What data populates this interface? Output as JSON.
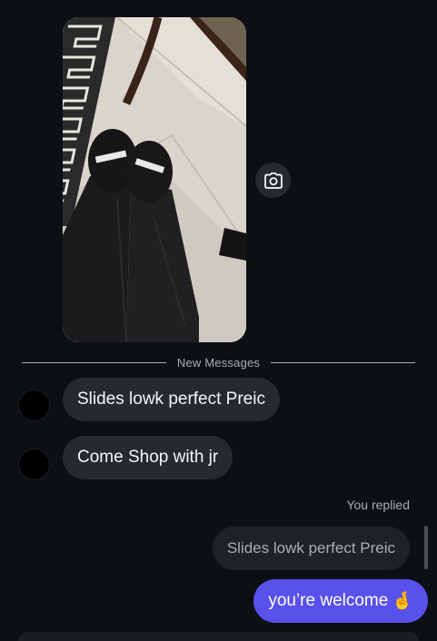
{
  "thread": {
    "photo": {
      "description_icon": "shared-photo",
      "camera_icon": "camera-icon"
    },
    "divider_label": "New Messages",
    "incoming_messages": [
      {
        "text": "Slides lowk perfect Preic"
      },
      {
        "text": "Come Shop with jr"
      }
    ],
    "replied_label": "You replied",
    "reply_quote": "Slides lowk perfect Preic",
    "outgoing_message": "you’re welcome",
    "outgoing_emoji": "🤞",
    "colors": {
      "background": "#0c1014",
      "incoming_bubble": "#262a2f",
      "outgoing_bubble": "#5851ec",
      "muted_text": "#a8adb3"
    }
  }
}
